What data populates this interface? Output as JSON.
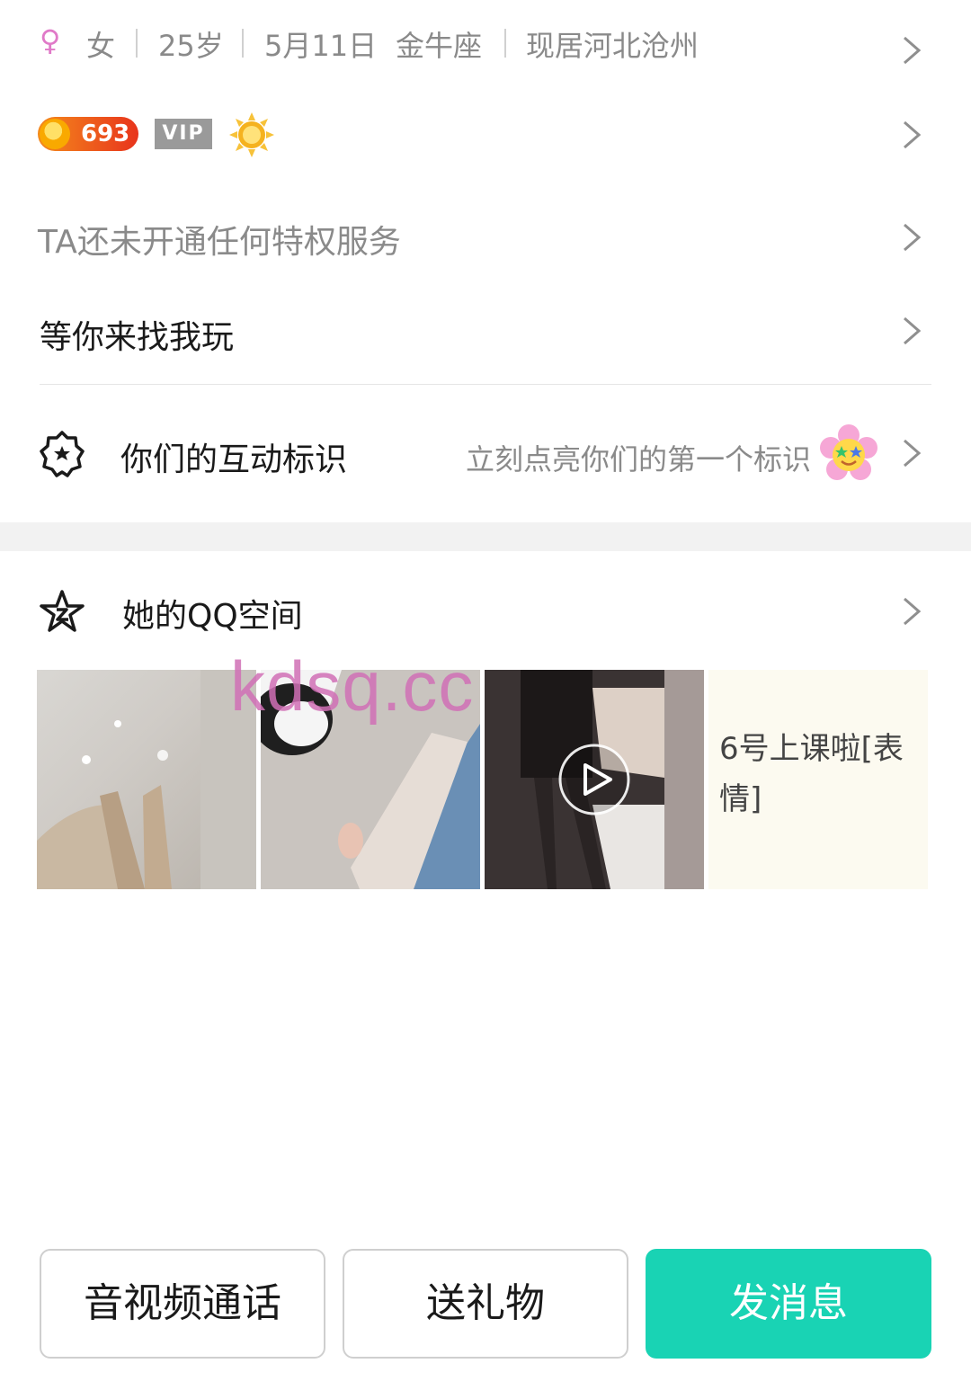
{
  "profile": {
    "gender_symbol": "♀",
    "gender": "女",
    "age": "25岁",
    "birthday": "5月11日",
    "zodiac": "金牛座",
    "location": "现居河北沧州"
  },
  "badges": {
    "coin_count": "693",
    "vip_label": "VIP"
  },
  "privilege": {
    "text": "TA还未开通任何特权服务"
  },
  "signature": {
    "text": "等你来找我玩"
  },
  "interaction": {
    "title": "你们的互动标识",
    "hint": "立刻点亮你们的第一个标识"
  },
  "qzone": {
    "title": "她的QQ空间",
    "post_text": "6号上课啦[表情]"
  },
  "watermark": "kdsq.cc",
  "actions": {
    "call": "音视频通话",
    "gift": "送礼物",
    "message": "发消息"
  },
  "colors": {
    "accent": "#19d3b4",
    "gender": "#e07ac8",
    "coin_badge": "#e8341c",
    "watermark": "#d170b6"
  }
}
